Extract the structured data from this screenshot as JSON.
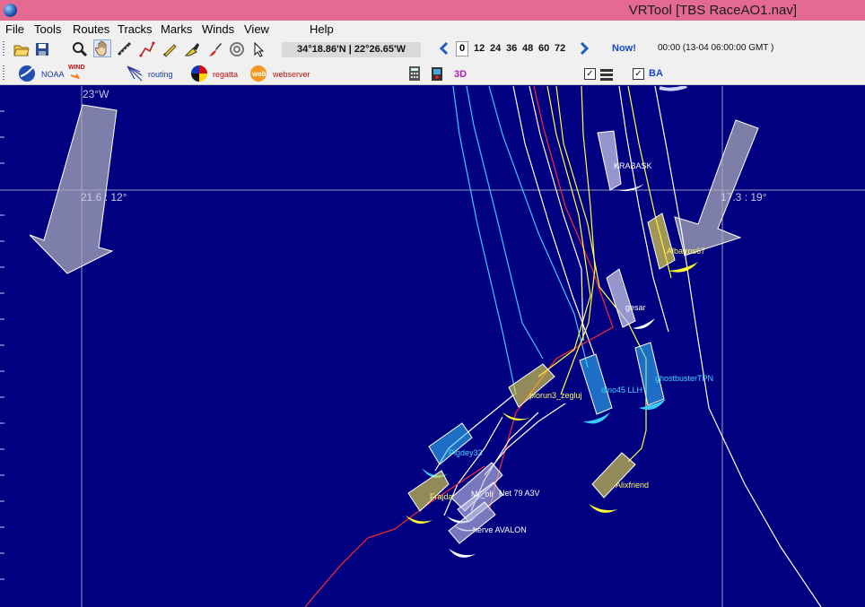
{
  "window": {
    "title": "VRTool [TBS RaceAO1.nav]"
  },
  "menu": [
    "File",
    "Tools",
    "Routes",
    "Tracks",
    "Marks",
    "Winds",
    "View",
    "Help"
  ],
  "toolbar": {
    "cursor_position": "34°18.86'N | 22°26.65'W",
    "forecast_hours": [
      "0",
      "12",
      "24",
      "36",
      "48",
      "60",
      "72"
    ],
    "selected_hour": "0",
    "now_label": "Now!",
    "time_info": "00:00 (13-04 06:00:00 GMT )"
  },
  "toolbar2": {
    "noaa_label": "NOAA",
    "wind_label": "WIND",
    "routing_label": "routing",
    "regatta_label": "regatta",
    "webserver_label": "webserver",
    "three_d_label": "3D",
    "ba_label": "BA",
    "ba_checked": true,
    "layers_checked": true
  },
  "map": {
    "meridian_label": "23°W",
    "wind_readout_left": "21.6 : 12°",
    "wind_readout_right": "17.3 : 19°",
    "colors": {
      "sea": "#000080",
      "grid": "#9a9ac8",
      "own_track": "#ff2a2a",
      "yellow_track": "#ffff40",
      "cyan_track": "#39c8ff",
      "white_track": "#ffffff",
      "label_white": "#ffffff",
      "label_yellow": "#ffff60",
      "label_cyan": "#40d8ff"
    },
    "boats": [
      {
        "name": "KRABASK",
        "color": "white"
      },
      {
        "name": "Albatros67",
        "color": "yellow"
      },
      {
        "name": "gesar",
        "color": "white"
      },
      {
        "name": "ghostbusterTPN",
        "color": "cyan"
      },
      {
        "name": "dino45 LLH",
        "color": "cyan"
      },
      {
        "name": "piorun3_zegluj",
        "color": "yellow"
      },
      {
        "name": "Pigdey33",
        "color": "cyan"
      },
      {
        "name": "Frajda",
        "color": "yellow"
      },
      {
        "name": "Mr_oli",
        "color": "white"
      },
      {
        "name": "Net 79 A3V",
        "color": "white"
      },
      {
        "name": "herve AVALON",
        "color": "white"
      },
      {
        "name": "Alixfriend",
        "color": "yellow"
      }
    ]
  }
}
